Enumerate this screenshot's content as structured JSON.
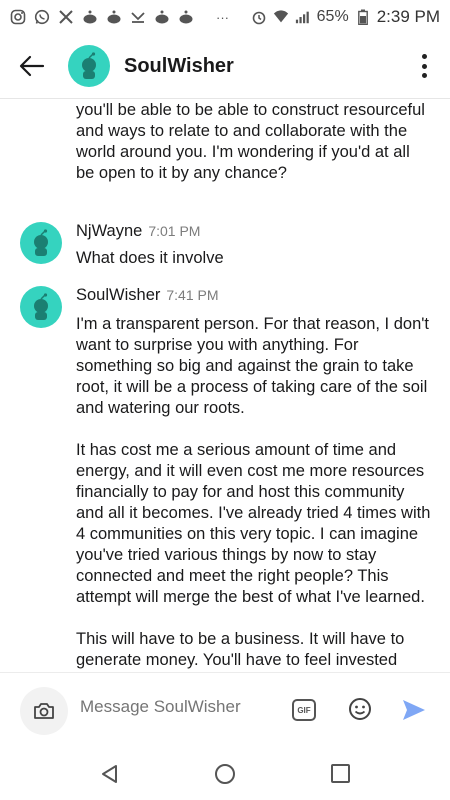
{
  "status_bar": {
    "battery": "65%",
    "time": "2:39 PM",
    "more": "···"
  },
  "header": {
    "title": "SoulWisher",
    "avatar_color": "#35d3bf"
  },
  "chat": {
    "continued_text": "you'll be able to be able to construct resourceful and ways to relate to and collaborate with the world around you. I'm wondering if you'd at all be open to it by any chance?",
    "messages": [
      {
        "author": "NjWayne",
        "time": "7:01 PM",
        "paragraphs": [
          "What does it involve"
        ]
      },
      {
        "author": "SoulWisher",
        "time": "7:41 PM",
        "paragraphs": [
          "I'm a transparent person. For that reason, I don't want to surprise you with anything. For something so big and against the grain to take root, it will be a process of taking care of the soil and watering our roots.",
          "It has cost me a serious amount of time and energy, and it will even cost me more resources financially to pay for and host this community and all it becomes. I've already tried 4 times with 4 communities on this very topic. I can imagine you've tried various things by now to stay connected and meet the right people? This attempt will merge the best of what I've learned.",
          "This will have to be a business. It will have to generate money. You'll have to feel invested"
        ]
      }
    ]
  },
  "composer": {
    "placeholder": "Message SoulWisher",
    "gif_label": "GIF",
    "send_color": "#7fa7f5"
  }
}
